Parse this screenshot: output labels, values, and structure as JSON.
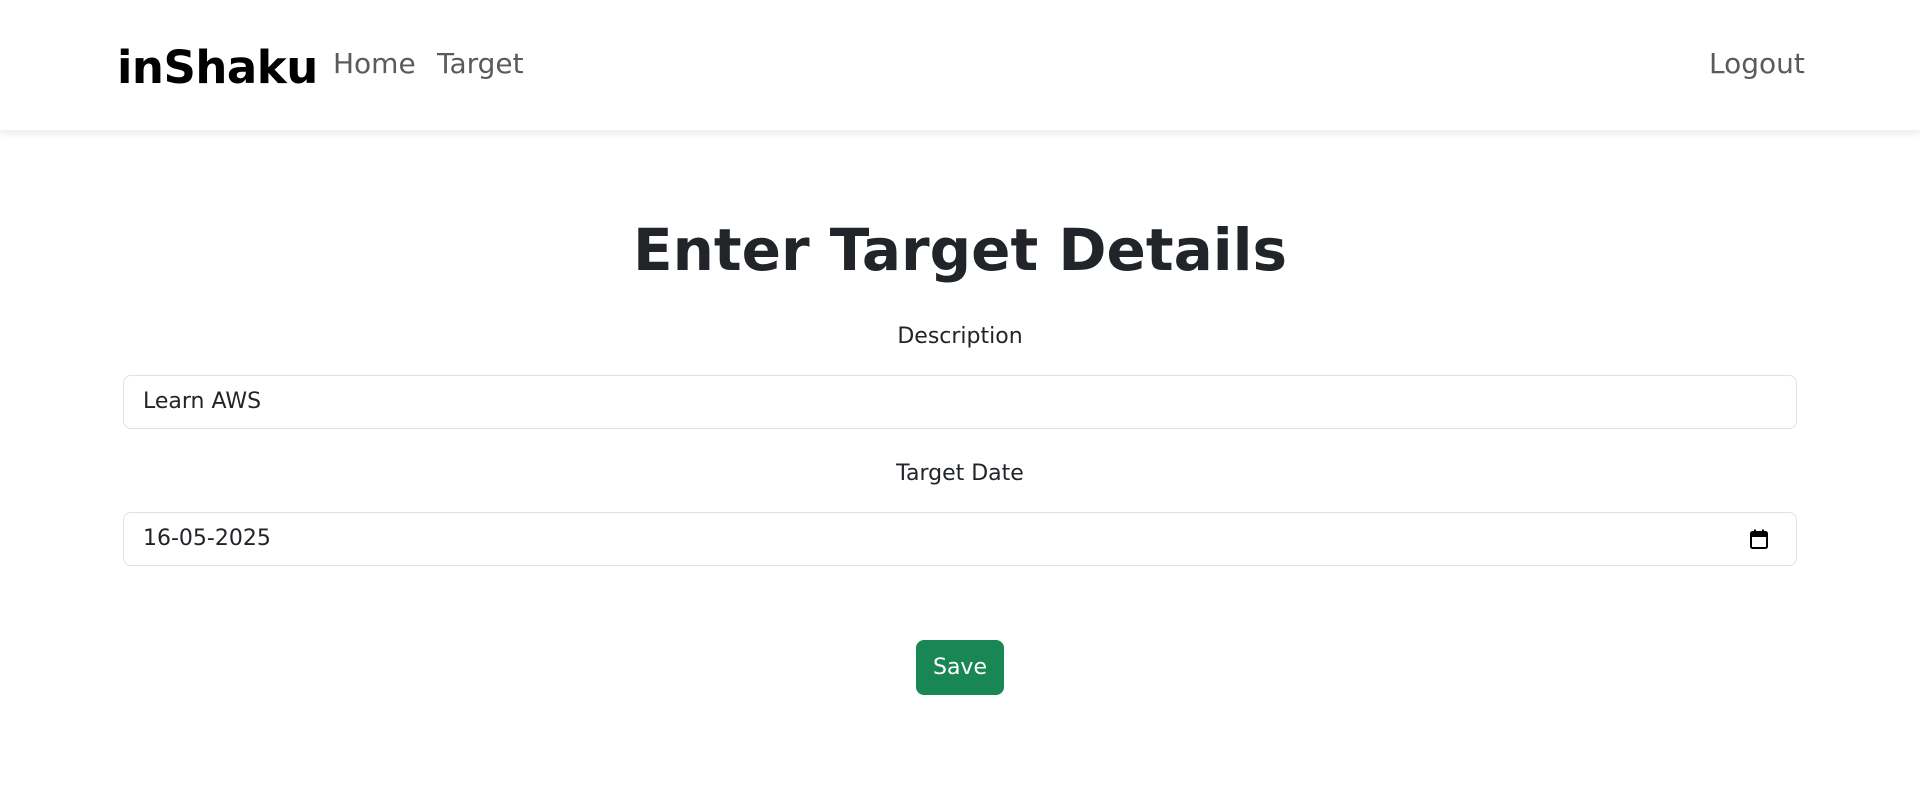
{
  "navbar": {
    "brand": "inShaku",
    "links": [
      {
        "label": "Home"
      },
      {
        "label": "Target"
      }
    ],
    "logout_label": "Logout"
  },
  "form": {
    "title": "Enter Target Details",
    "description_label": "Description",
    "description_value": "Learn AWS",
    "date_label": "Target Date",
    "date_value": "16-05-2025",
    "save_label": "Save"
  },
  "icons": {
    "date_picker": "calendar-icon"
  },
  "colors": {
    "save_button": "#198754",
    "nav_link": "#595c5f",
    "brand": "#000000"
  }
}
